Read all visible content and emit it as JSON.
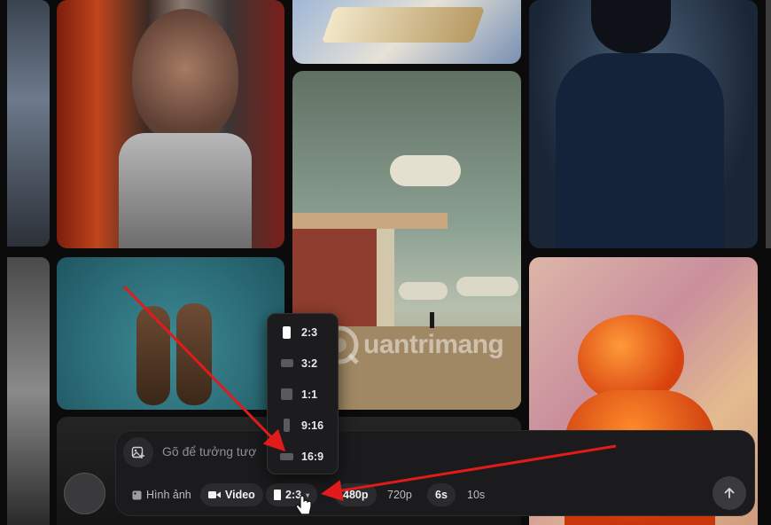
{
  "prompt": {
    "placeholder": "Gõ để tưởng tượ"
  },
  "chips": {
    "image": "Hình ảnh",
    "video": "Video",
    "ratio": "2:3",
    "res_480": "480p",
    "res_720": "720p",
    "dur_6": "6s",
    "dur_10": "10s"
  },
  "ratio_menu": {
    "options": [
      {
        "label": "2:3",
        "selected": true
      },
      {
        "label": "3:2",
        "selected": false
      },
      {
        "label": "1:1",
        "selected": false
      },
      {
        "label": "9:16",
        "selected": false
      },
      {
        "label": "16:9",
        "selected": false
      }
    ]
  },
  "watermark": {
    "text": "uantrimang"
  },
  "colors": {
    "accent_red": "#e11b1b",
    "panel": "#1b1b1d",
    "chip_active": "#2b2b2e"
  },
  "icons": [
    "attach-image-icon",
    "image-icon",
    "video-camera-icon",
    "send-arrow-icon",
    "cursor-hand-icon"
  ]
}
